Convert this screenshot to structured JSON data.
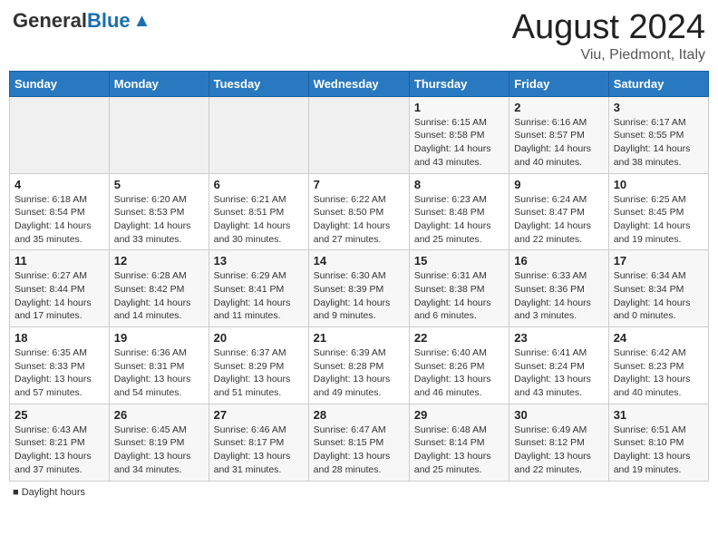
{
  "header": {
    "logo_general": "General",
    "logo_blue": "Blue",
    "month_year": "August 2024",
    "location": "Viu, Piedmont, Italy"
  },
  "legend": {
    "daylight_hours": "Daylight hours"
  },
  "weekdays": [
    "Sunday",
    "Monday",
    "Tuesday",
    "Wednesday",
    "Thursday",
    "Friday",
    "Saturday"
  ],
  "weeks": [
    [
      {
        "day": "",
        "info": ""
      },
      {
        "day": "",
        "info": ""
      },
      {
        "day": "",
        "info": ""
      },
      {
        "day": "",
        "info": ""
      },
      {
        "day": "1",
        "info": "Sunrise: 6:15 AM\nSunset: 8:58 PM\nDaylight: 14 hours and 43 minutes."
      },
      {
        "day": "2",
        "info": "Sunrise: 6:16 AM\nSunset: 8:57 PM\nDaylight: 14 hours and 40 minutes."
      },
      {
        "day": "3",
        "info": "Sunrise: 6:17 AM\nSunset: 8:55 PM\nDaylight: 14 hours and 38 minutes."
      }
    ],
    [
      {
        "day": "4",
        "info": "Sunrise: 6:18 AM\nSunset: 8:54 PM\nDaylight: 14 hours and 35 minutes."
      },
      {
        "day": "5",
        "info": "Sunrise: 6:20 AM\nSunset: 8:53 PM\nDaylight: 14 hours and 33 minutes."
      },
      {
        "day": "6",
        "info": "Sunrise: 6:21 AM\nSunset: 8:51 PM\nDaylight: 14 hours and 30 minutes."
      },
      {
        "day": "7",
        "info": "Sunrise: 6:22 AM\nSunset: 8:50 PM\nDaylight: 14 hours and 27 minutes."
      },
      {
        "day": "8",
        "info": "Sunrise: 6:23 AM\nSunset: 8:48 PM\nDaylight: 14 hours and 25 minutes."
      },
      {
        "day": "9",
        "info": "Sunrise: 6:24 AM\nSunset: 8:47 PM\nDaylight: 14 hours and 22 minutes."
      },
      {
        "day": "10",
        "info": "Sunrise: 6:25 AM\nSunset: 8:45 PM\nDaylight: 14 hours and 19 minutes."
      }
    ],
    [
      {
        "day": "11",
        "info": "Sunrise: 6:27 AM\nSunset: 8:44 PM\nDaylight: 14 hours and 17 minutes."
      },
      {
        "day": "12",
        "info": "Sunrise: 6:28 AM\nSunset: 8:42 PM\nDaylight: 14 hours and 14 minutes."
      },
      {
        "day": "13",
        "info": "Sunrise: 6:29 AM\nSunset: 8:41 PM\nDaylight: 14 hours and 11 minutes."
      },
      {
        "day": "14",
        "info": "Sunrise: 6:30 AM\nSunset: 8:39 PM\nDaylight: 14 hours and 9 minutes."
      },
      {
        "day": "15",
        "info": "Sunrise: 6:31 AM\nSunset: 8:38 PM\nDaylight: 14 hours and 6 minutes."
      },
      {
        "day": "16",
        "info": "Sunrise: 6:33 AM\nSunset: 8:36 PM\nDaylight: 14 hours and 3 minutes."
      },
      {
        "day": "17",
        "info": "Sunrise: 6:34 AM\nSunset: 8:34 PM\nDaylight: 14 hours and 0 minutes."
      }
    ],
    [
      {
        "day": "18",
        "info": "Sunrise: 6:35 AM\nSunset: 8:33 PM\nDaylight: 13 hours and 57 minutes."
      },
      {
        "day": "19",
        "info": "Sunrise: 6:36 AM\nSunset: 8:31 PM\nDaylight: 13 hours and 54 minutes."
      },
      {
        "day": "20",
        "info": "Sunrise: 6:37 AM\nSunset: 8:29 PM\nDaylight: 13 hours and 51 minutes."
      },
      {
        "day": "21",
        "info": "Sunrise: 6:39 AM\nSunset: 8:28 PM\nDaylight: 13 hours and 49 minutes."
      },
      {
        "day": "22",
        "info": "Sunrise: 6:40 AM\nSunset: 8:26 PM\nDaylight: 13 hours and 46 minutes."
      },
      {
        "day": "23",
        "info": "Sunrise: 6:41 AM\nSunset: 8:24 PM\nDaylight: 13 hours and 43 minutes."
      },
      {
        "day": "24",
        "info": "Sunrise: 6:42 AM\nSunset: 8:23 PM\nDaylight: 13 hours and 40 minutes."
      }
    ],
    [
      {
        "day": "25",
        "info": "Sunrise: 6:43 AM\nSunset: 8:21 PM\nDaylight: 13 hours and 37 minutes."
      },
      {
        "day": "26",
        "info": "Sunrise: 6:45 AM\nSunset: 8:19 PM\nDaylight: 13 hours and 34 minutes."
      },
      {
        "day": "27",
        "info": "Sunrise: 6:46 AM\nSunset: 8:17 PM\nDaylight: 13 hours and 31 minutes."
      },
      {
        "day": "28",
        "info": "Sunrise: 6:47 AM\nSunset: 8:15 PM\nDaylight: 13 hours and 28 minutes."
      },
      {
        "day": "29",
        "info": "Sunrise: 6:48 AM\nSunset: 8:14 PM\nDaylight: 13 hours and 25 minutes."
      },
      {
        "day": "30",
        "info": "Sunrise: 6:49 AM\nSunset: 8:12 PM\nDaylight: 13 hours and 22 minutes."
      },
      {
        "day": "31",
        "info": "Sunrise: 6:51 AM\nSunset: 8:10 PM\nDaylight: 13 hours and 19 minutes."
      }
    ]
  ]
}
